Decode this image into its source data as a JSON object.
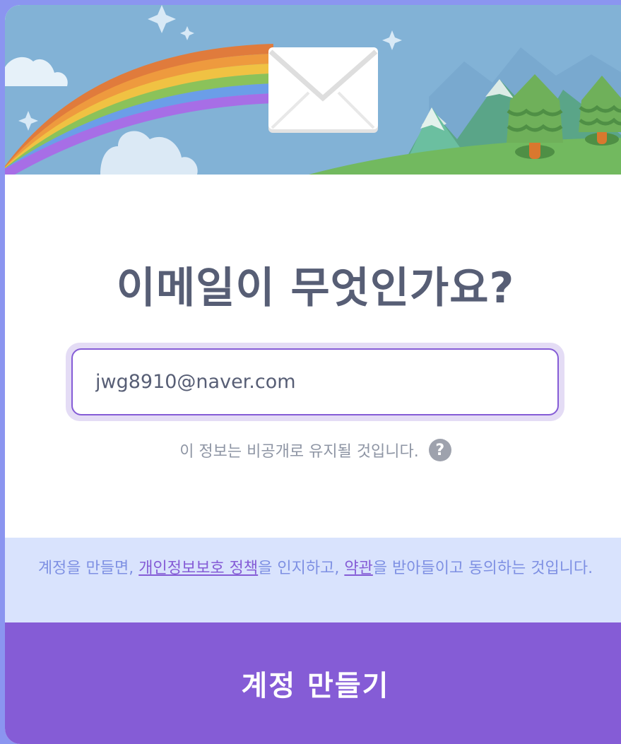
{
  "header": {
    "title": "이메일이 무엇인가요?"
  },
  "email": {
    "value": "jwg8910@naver.com"
  },
  "privacy": {
    "text": "이 정보는 비공개로 유지될 것입니다.",
    "help_icon": "question-circle-icon"
  },
  "terms": {
    "part1": "계정을 만들면, ",
    "privacy_link": "개인정보보호 정책",
    "part2": "을 인지하고, ",
    "terms_link": "약관",
    "part3": "을 받아들이고 동의하는 것입니다."
  },
  "submit": {
    "label": "계정 만들기"
  },
  "colors": {
    "accent": "#855cd6",
    "text": "#575e75",
    "frame": "#8b95f0",
    "terms_bg": "#d9e3fd"
  }
}
